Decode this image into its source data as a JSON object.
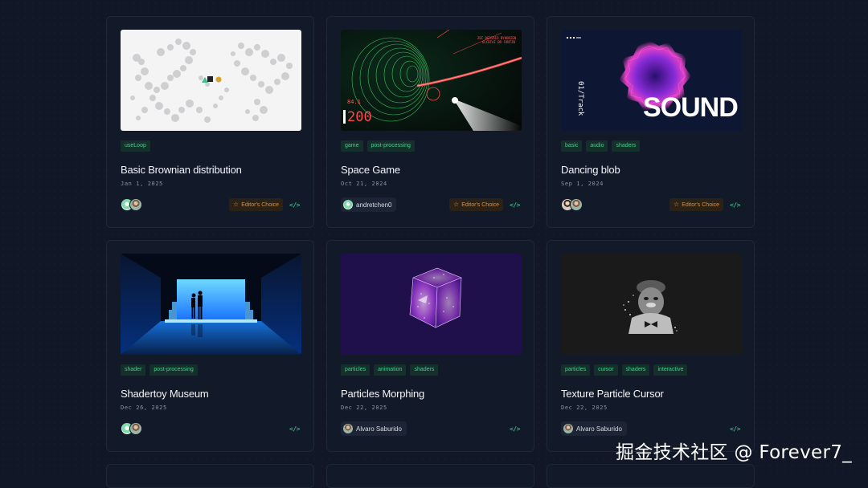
{
  "cards": [
    {
      "title": "Basic Brownian distribution",
      "date": "Jan 1, 2025",
      "tags": [
        "useLoop"
      ],
      "badge": "Editor's Choice",
      "thumbnail": "brownian-distribution",
      "author_style": "avatars"
    },
    {
      "title": "Space Game",
      "date": "Oct 21, 2024",
      "tags": [
        "game",
        "post-processing"
      ],
      "badge": "Editor's Choice",
      "author": "andretchen0",
      "thumbnail": "space-game",
      "hud_small": "84.1",
      "hud_big": "200"
    },
    {
      "title": "Dancing blob",
      "date": "Sep 1, 2024",
      "tags": [
        "basic",
        "audio",
        "shaders"
      ],
      "badge": "Editor's Choice",
      "thumbnail": "sound-blob",
      "thumb_word": "SOUND",
      "thumb_track": "01/Track",
      "author_style": "avatars"
    },
    {
      "title": "Shadertoy Museum",
      "date": "Dec 26, 2025",
      "tags": [
        "shader",
        "post-processing"
      ],
      "thumbnail": "museum",
      "author_style": "avatars"
    },
    {
      "title": "Particles Morphing",
      "date": "Dec 22, 2025",
      "tags": [
        "particles",
        "animation",
        "shaders"
      ],
      "author": "Alvaro Saburido",
      "thumbnail": "particle-cube"
    },
    {
      "title": "Texture Particle Cursor",
      "date": "Dec 22, 2025",
      "tags": [
        "particles",
        "cursor",
        "shaders",
        "interactive"
      ],
      "author": "Alvaro Saburido",
      "thumbnail": "particle-portrait"
    }
  ],
  "code_icon": "</>",
  "watermark": "掘金技术社区 @ Forever7_",
  "colors": {
    "background": "#111726",
    "card": "#121a2a",
    "tag_text": "#3ecf8e",
    "badge_text": "#d99040"
  }
}
